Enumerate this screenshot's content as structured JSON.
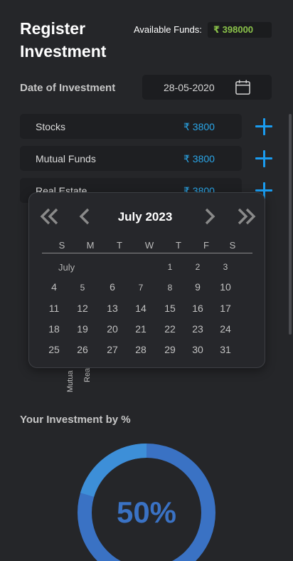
{
  "header": {
    "title_line1": "Register",
    "title_line2": "Investment",
    "funds_label": "Available Funds:",
    "funds_value": "₹ 398000",
    "funds_color": "#8bc34a"
  },
  "date_field": {
    "label": "Date of Investment",
    "value": "28-05-2020",
    "icon": "calendar-icon"
  },
  "investments": [
    {
      "name": "Stocks",
      "amount": "₹ 3800"
    },
    {
      "name": "Mutual Funds",
      "amount": "₹ 3800"
    },
    {
      "name": "Real Estate",
      "amount": "₹ 3800"
    }
  ],
  "accent_color": "#1a9cf0",
  "calendar": {
    "month_title": "July 2023",
    "month_sub": "July",
    "weekdays": [
      "S",
      "M",
      "T",
      "W",
      "T",
      "F",
      "S"
    ],
    "weeks": [
      [
        "",
        "",
        "",
        "",
        "1",
        "2",
        "3"
      ],
      [
        "4",
        "5",
        "6",
        "7",
        "8",
        "9",
        "10"
      ],
      [
        "11",
        "12",
        "13",
        "14",
        "15",
        "16",
        "17"
      ],
      [
        "18",
        "19",
        "20",
        "21",
        "22",
        "23",
        "24"
      ],
      [
        "25",
        "26",
        "27",
        "28",
        "29",
        "30",
        "31"
      ]
    ],
    "nav": {
      "prev_year": "double-chevron-left-icon",
      "prev_month": "chevron-left-icon",
      "next_month": "chevron-right-icon",
      "next_year": "double-chevron-right-icon"
    }
  },
  "bar_labels": [
    "Mutua",
    "Rea"
  ],
  "chart_section": {
    "title": "Your Investment by %",
    "center_value": "50%",
    "ring_colors": [
      "#3a72c4",
      "#3d8fd8"
    ]
  }
}
